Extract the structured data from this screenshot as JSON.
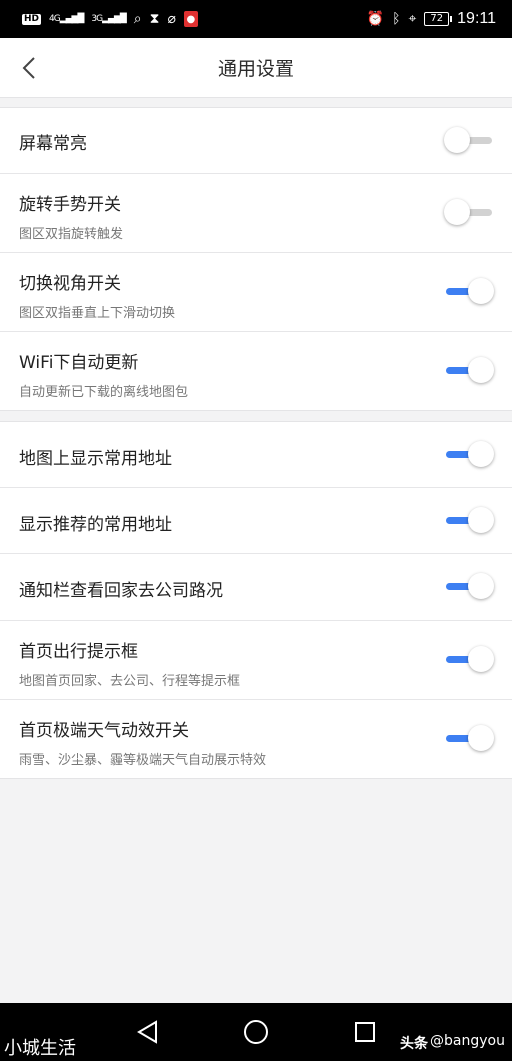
{
  "status_bar": {
    "left_icons": [
      "hd-icon",
      "4g-signal-icon",
      "3g-signal-icon",
      "search-icon",
      "hourglass-icon",
      "no-location-icon",
      "mic-recording-icon"
    ],
    "hd": "HD",
    "sig1": "4G",
    "sig2": "3G",
    "battery": "72",
    "time": "19:11"
  },
  "header": {
    "title": "通用设置",
    "back_icon": "chevron-left-icon"
  },
  "settings": {
    "screen_on": {
      "title": "屏幕常亮",
      "on": false
    },
    "rotate_gesture": {
      "title": "旋转手势开关",
      "subtitle": "图区双指旋转触发",
      "on": false
    },
    "switch_view": {
      "title": "切换视角开关",
      "subtitle": "图区双指垂直上下滑动切换",
      "on": true
    },
    "wifi_update": {
      "title": "WiFi下自动更新",
      "subtitle": "自动更新已下载的离线地图包",
      "on": true
    },
    "show_common_addr": {
      "title": "地图上显示常用地址",
      "on": true
    },
    "show_recommended": {
      "title": "显示推荐的常用地址",
      "on": true
    },
    "notify_traffic": {
      "title": "通知栏查看回家去公司路况",
      "on": true
    },
    "home_trip_hint": {
      "title": "首页出行提示框",
      "subtitle": "地图首页回家、去公司、行程等提示框",
      "on": true
    },
    "extreme_weather": {
      "title": "首页极端天气动效开关",
      "subtitle": "雨雪、沙尘暴、霾等极端天气自动展示特效",
      "on": true
    }
  },
  "colors": {
    "accent": "#3d7ff2",
    "track_off": "#d2d2d2"
  },
  "watermark": {
    "left": "小城生活",
    "right_bold": "头条",
    "right_handle": "@bangyou"
  }
}
